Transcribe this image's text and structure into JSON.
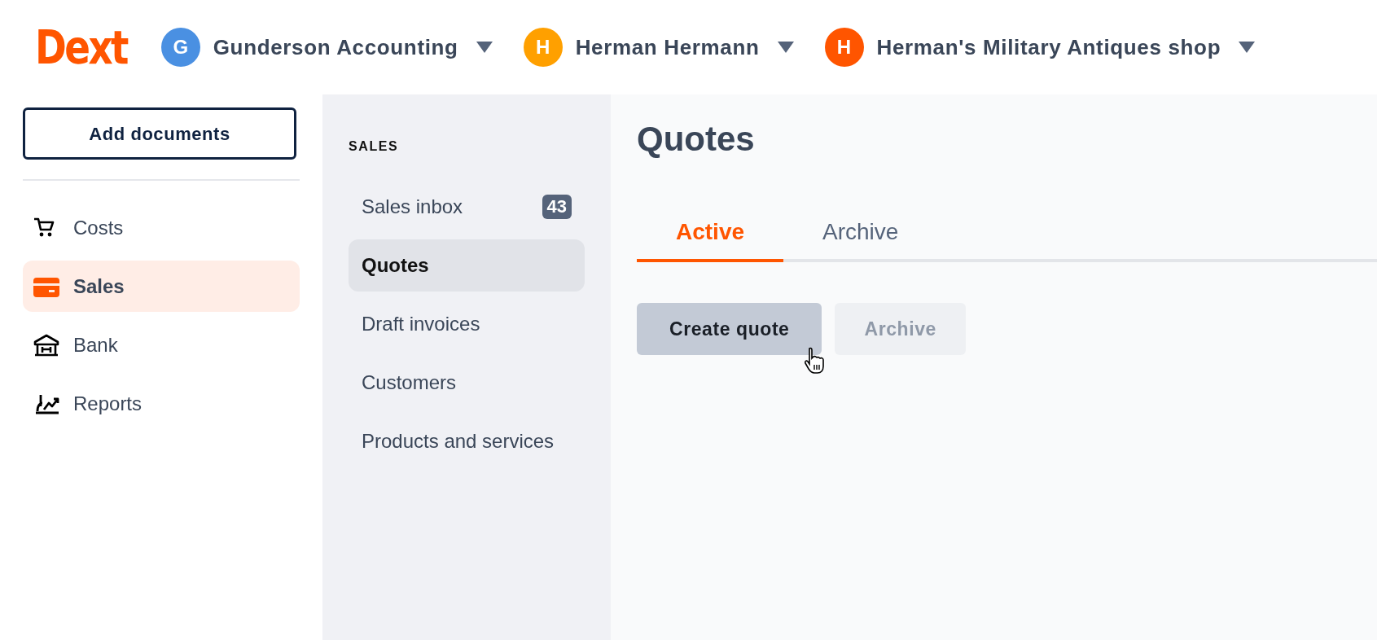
{
  "header": {
    "logo": "Dext",
    "accounts": [
      {
        "initial": "G",
        "name": "Gunderson Accounting",
        "color": "#4a90e2"
      },
      {
        "initial": "H",
        "name": "Herman Hermann",
        "color": "#ffa000"
      },
      {
        "initial": "H",
        "name": "Herman's Military Antiques shop",
        "color": "#ff5500"
      }
    ]
  },
  "sidebar": {
    "add_button": "Add documents",
    "items": [
      {
        "kind": "cart",
        "label": "Costs",
        "selected": false
      },
      {
        "kind": "card",
        "label": "Sales",
        "selected": true
      },
      {
        "kind": "bank",
        "label": "Bank",
        "selected": false
      },
      {
        "kind": "chart",
        "label": "Reports",
        "selected": false
      }
    ]
  },
  "subnav": {
    "heading": "SALES",
    "items": [
      {
        "label": "Sales inbox",
        "badge": "43",
        "selected": false
      },
      {
        "label": "Quotes",
        "selected": true
      },
      {
        "label": "Draft invoices",
        "selected": false
      },
      {
        "label": "Customers",
        "selected": false
      },
      {
        "label": "Products and services",
        "selected": false
      }
    ]
  },
  "main": {
    "title": "Quotes",
    "tabs": [
      {
        "label": "Active",
        "selected": true
      },
      {
        "label": "Archive",
        "selected": false
      }
    ],
    "buttons": [
      {
        "label": "Create quote",
        "disabled": false
      },
      {
        "label": "Archive",
        "disabled": true
      }
    ]
  }
}
